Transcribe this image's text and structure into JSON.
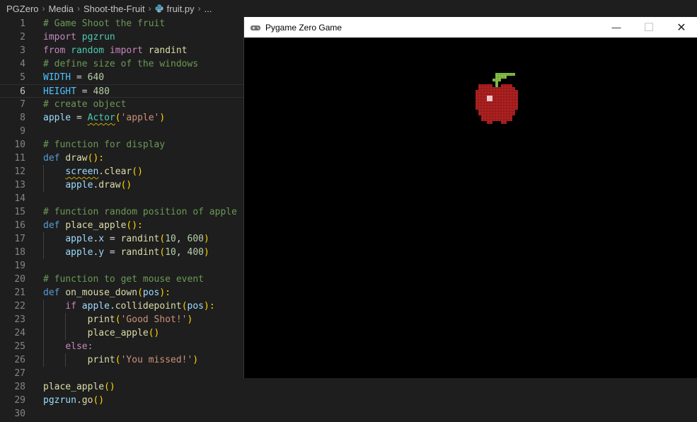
{
  "breadcrumb": {
    "items": [
      "PGZero",
      "Media",
      "Shoot-the-Fruit",
      "fruit.py",
      "..."
    ]
  },
  "editor": {
    "lines": [
      [
        [
          "# Game Shoot the fruit",
          "cmt"
        ]
      ],
      [
        [
          "import",
          "kw"
        ],
        [
          " ",
          "op"
        ],
        [
          "pgzrun",
          "mod"
        ]
      ],
      [
        [
          "from",
          "kw"
        ],
        [
          " ",
          "op"
        ],
        [
          "random",
          "mod"
        ],
        [
          " ",
          "op"
        ],
        [
          "import",
          "kw"
        ],
        [
          " ",
          "op"
        ],
        [
          "randint",
          "fn"
        ]
      ],
      [
        [
          "# define size of the windows",
          "cmt"
        ]
      ],
      [
        [
          "WIDTH",
          "con"
        ],
        [
          " = ",
          "op"
        ],
        [
          "640",
          "num"
        ]
      ],
      [
        [
          "HEIGHT",
          "con"
        ],
        [
          " = ",
          "op"
        ],
        [
          "480",
          "num"
        ]
      ],
      [
        [
          "# create object",
          "cmt"
        ]
      ],
      [
        [
          "apple",
          "var"
        ],
        [
          " = ",
          "op"
        ],
        [
          "Actor",
          "mod",
          "squiggle"
        ],
        [
          "(",
          "p1"
        ],
        [
          "'apple'",
          "str"
        ],
        [
          ")",
          "p1"
        ]
      ],
      [],
      [
        [
          "# function for display",
          "cmt"
        ]
      ],
      [
        [
          "def",
          "def"
        ],
        [
          " ",
          "op"
        ],
        [
          "draw",
          "fn"
        ],
        [
          "():",
          "p1"
        ]
      ],
      [
        [
          "    ",
          "op"
        ],
        [
          "screen",
          "var",
          "squiggle"
        ],
        [
          ".",
          "op"
        ],
        [
          "clear",
          "fn"
        ],
        [
          "()",
          "p1"
        ]
      ],
      [
        [
          "    ",
          "op"
        ],
        [
          "apple",
          "var"
        ],
        [
          ".",
          "op"
        ],
        [
          "draw",
          "fn"
        ],
        [
          "()",
          "p1"
        ]
      ],
      [],
      [
        [
          "# function random position of apple",
          "cmt"
        ]
      ],
      [
        [
          "def",
          "def"
        ],
        [
          " ",
          "op"
        ],
        [
          "place_apple",
          "fn"
        ],
        [
          "():",
          "p1"
        ]
      ],
      [
        [
          "    ",
          "op"
        ],
        [
          "apple",
          "var"
        ],
        [
          ".",
          "op"
        ],
        [
          "x",
          "var"
        ],
        [
          " = ",
          "op"
        ],
        [
          "randint",
          "fn"
        ],
        [
          "(",
          "p1"
        ],
        [
          "10",
          "num"
        ],
        [
          ", ",
          "op"
        ],
        [
          "600",
          "num"
        ],
        [
          ")",
          "p1"
        ]
      ],
      [
        [
          "    ",
          "op"
        ],
        [
          "apple",
          "var"
        ],
        [
          ".",
          "op"
        ],
        [
          "y",
          "var"
        ],
        [
          " = ",
          "op"
        ],
        [
          "randint",
          "fn"
        ],
        [
          "(",
          "p1"
        ],
        [
          "10",
          "num"
        ],
        [
          ", ",
          "op"
        ],
        [
          "400",
          "num"
        ],
        [
          ")",
          "p1"
        ]
      ],
      [],
      [
        [
          "# function to get mouse event",
          "cmt"
        ]
      ],
      [
        [
          "def",
          "def"
        ],
        [
          " ",
          "op"
        ],
        [
          "on_mouse_down",
          "fn"
        ],
        [
          "(",
          "p1"
        ],
        [
          "pos",
          "var"
        ],
        [
          "):",
          "p1"
        ]
      ],
      [
        [
          "    ",
          "op"
        ],
        [
          "if",
          "kw"
        ],
        [
          " ",
          "op"
        ],
        [
          "apple",
          "var"
        ],
        [
          ".",
          "op"
        ],
        [
          "collidepoint",
          "fn"
        ],
        [
          "(",
          "p1"
        ],
        [
          "pos",
          "var"
        ],
        [
          "):",
          "p1"
        ]
      ],
      [
        [
          "        ",
          "op"
        ],
        [
          "print",
          "fn"
        ],
        [
          "(",
          "p1"
        ],
        [
          "'Good Shot!'",
          "str"
        ],
        [
          ")",
          "p1"
        ]
      ],
      [
        [
          "        ",
          "op"
        ],
        [
          "place_apple",
          "fn"
        ],
        [
          "()",
          "p1"
        ]
      ],
      [
        [
          "    ",
          "op"
        ],
        [
          "else:",
          "kw"
        ]
      ],
      [
        [
          "        ",
          "op"
        ],
        [
          "print",
          "fn"
        ],
        [
          "(",
          "p1"
        ],
        [
          "'You missed!'",
          "str"
        ],
        [
          ")",
          "p1"
        ]
      ],
      [],
      [
        [
          "place_apple",
          "fn"
        ],
        [
          "()",
          "p1"
        ]
      ],
      [
        [
          "pgzrun",
          "var"
        ],
        [
          ".",
          "op"
        ],
        [
          "go",
          "fn"
        ],
        [
          "()",
          "p1"
        ]
      ],
      []
    ],
    "current_line": 6
  },
  "pygame_window": {
    "title": "Pygame Zero Game",
    "minimize_glyph": "—",
    "maximize_glyph": "☐",
    "close_glyph": "✕",
    "sprite": "apple"
  },
  "colors": {
    "editor_bg": "#1e1e1e",
    "comment": "#6a9955",
    "keyword": "#c586c0",
    "def": "#569cd6",
    "function": "#dcdcaa",
    "variable": "#9cdcfe",
    "constant": "#4fc1ff",
    "number": "#b5cea8",
    "string": "#ce9178",
    "bracket": "#ffd700",
    "apple_red": "#b22222",
    "apple_leaf": "#8bc34a"
  }
}
